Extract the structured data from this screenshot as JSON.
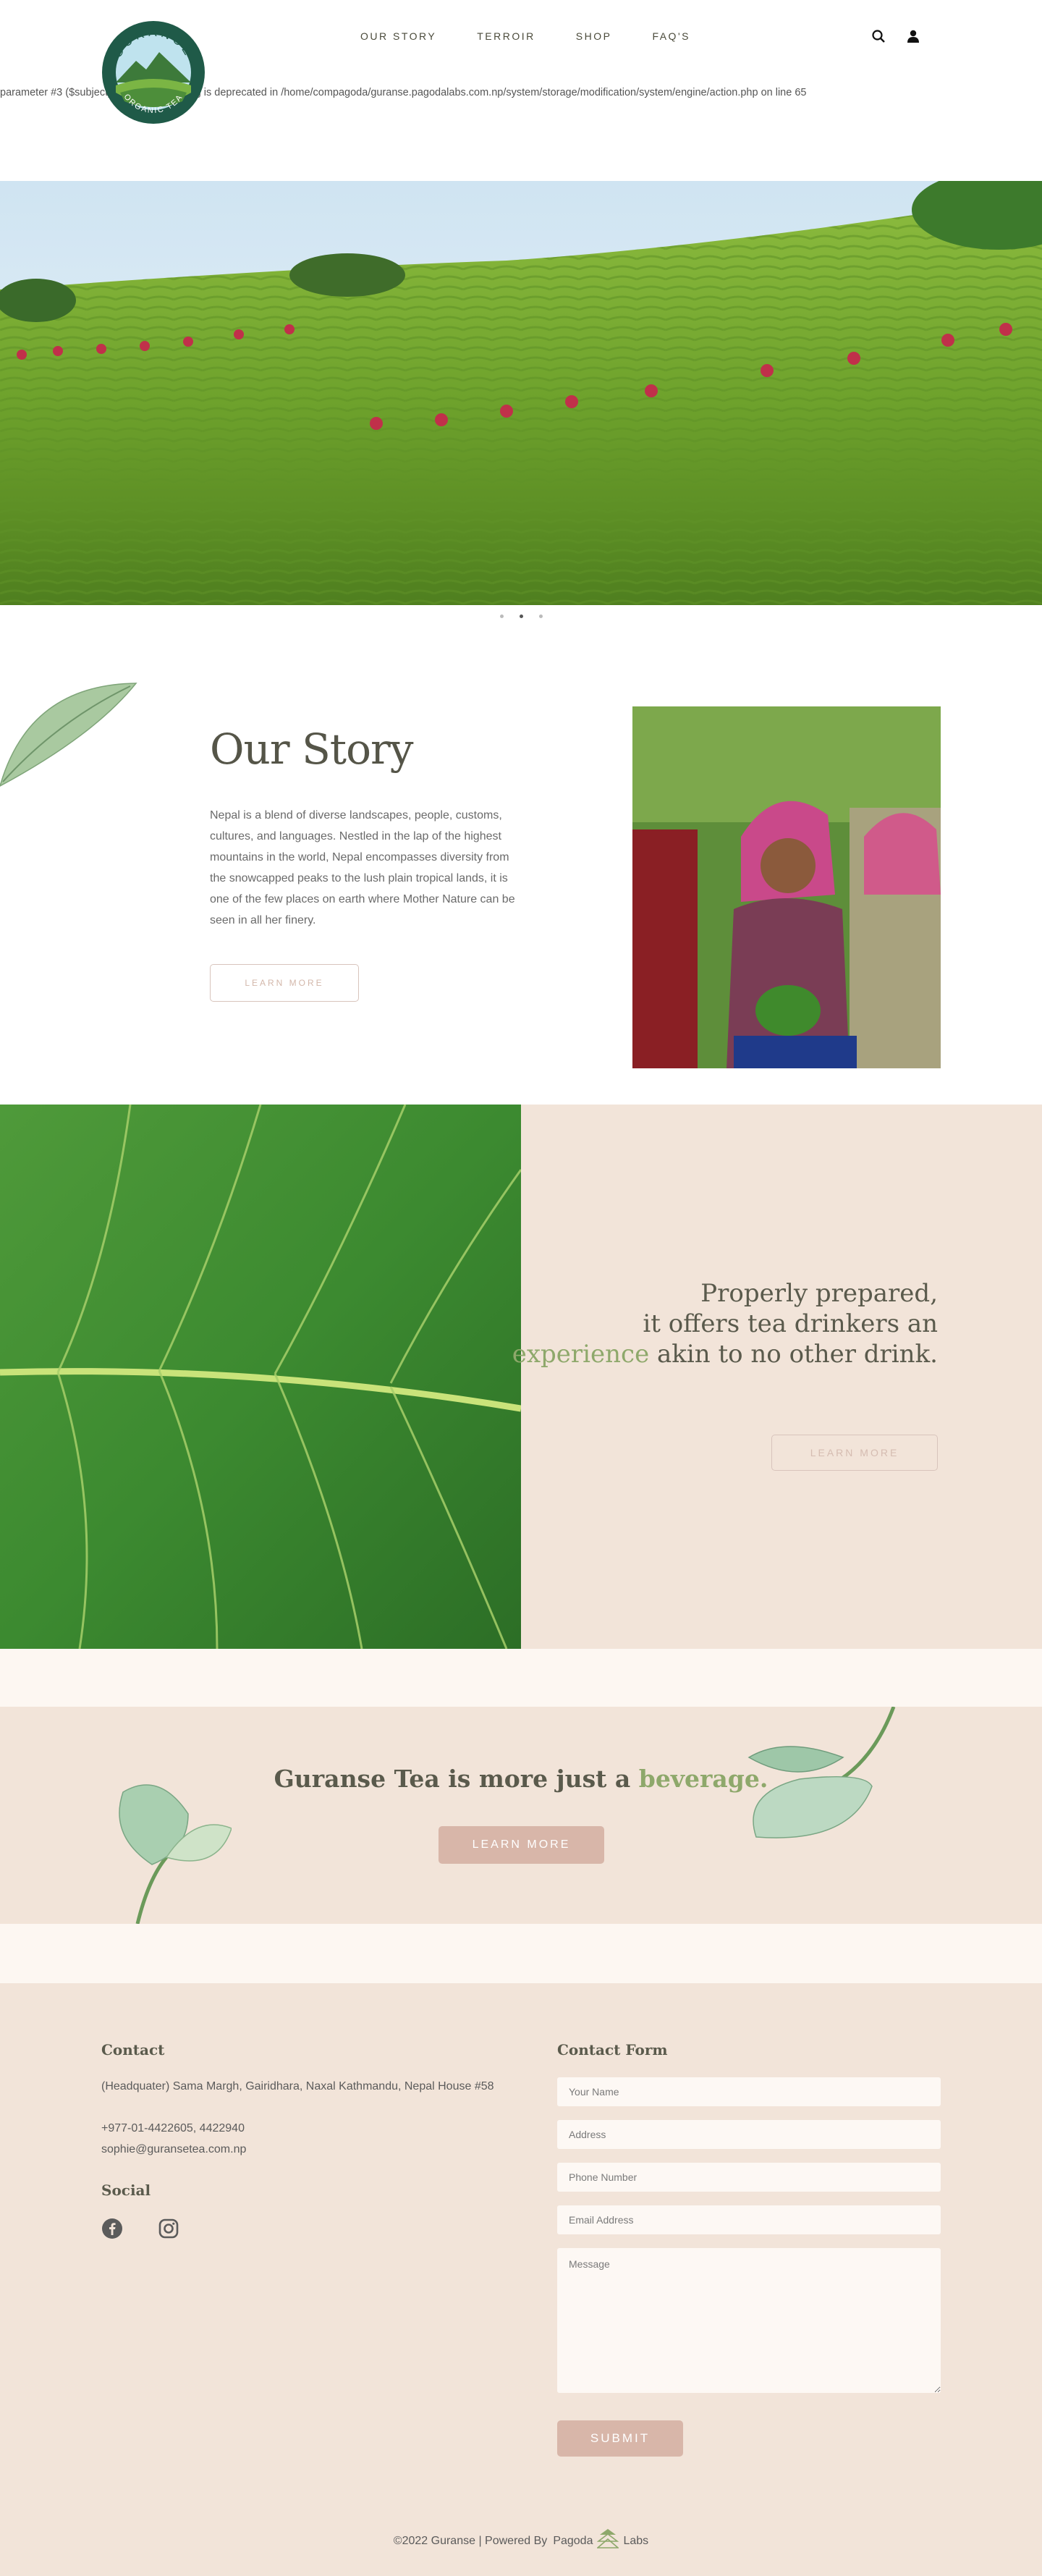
{
  "brand": {
    "logo_top_text": "GURANSE",
    "logo_bottom_text": "ORGANIC TEA"
  },
  "nav": {
    "items": [
      {
        "label": "OUR STORY"
      },
      {
        "label": "TERROIR"
      },
      {
        "label": "SHOP"
      },
      {
        "label": "FAQ'S"
      }
    ]
  },
  "header_icons": [
    "search-icon",
    "user-icon"
  ],
  "notice": {
    "text": "parameter #3 ($subject) of type array|string is deprecated in /home/compagoda/guranse.pagodalabs.com.np/system/storage/modification/system/engine/action.php on line 65"
  },
  "hero": {
    "slides": 3,
    "active_slide": 2
  },
  "story": {
    "title": "Our Story",
    "body": "Nepal is a blend of diverse landscapes, people, customs, cultures, and languages. Nestled in the lap of the highest mountains in the world, Nepal encompasses diversity from the snowcapped peaks to the lush plain tropical lands, it is one of the few places on earth where Mother Nature can be seen in all her finery.",
    "button_label": "LEARN MORE"
  },
  "experience": {
    "line1": "Properly prepared,",
    "line2": "it offers tea drinkers an",
    "highlight": "experience",
    "line3_rest": " akin to no other drink.",
    "button_label": "LEARN MORE"
  },
  "beverage": {
    "text": "Guranse Tea is more just a ",
    "highlight": "beverage.",
    "button_label": "LEARN MORE"
  },
  "footer": {
    "contact_heading": "Contact",
    "address": "(Headquater) Sama Margh, Gairidhara, Naxal Kathmandu, Nepal House #58",
    "phone": "+977-01-4422605, 4422940",
    "email": "sophie@guransetea.com.np",
    "social_heading": "Social",
    "social_icons": [
      "facebook-icon",
      "instagram-icon"
    ],
    "form_heading": "Contact Form",
    "form": {
      "name_placeholder": "Your Name",
      "address_placeholder": "Address",
      "phone_placeholder": "Phone Number",
      "email_placeholder": "Email Address",
      "message_placeholder": "Message",
      "submit_label": "SUBMIT"
    },
    "copyright": "©2022 Guranse | Powered By",
    "powered_brand_left": "Pagoda",
    "powered_brand_right": "Labs"
  },
  "colors": {
    "accent_green": "#8ea86b",
    "beige": "#f2e4d9",
    "button_pink": "#d8b6a9",
    "text_dark": "#5a5a4c"
  }
}
